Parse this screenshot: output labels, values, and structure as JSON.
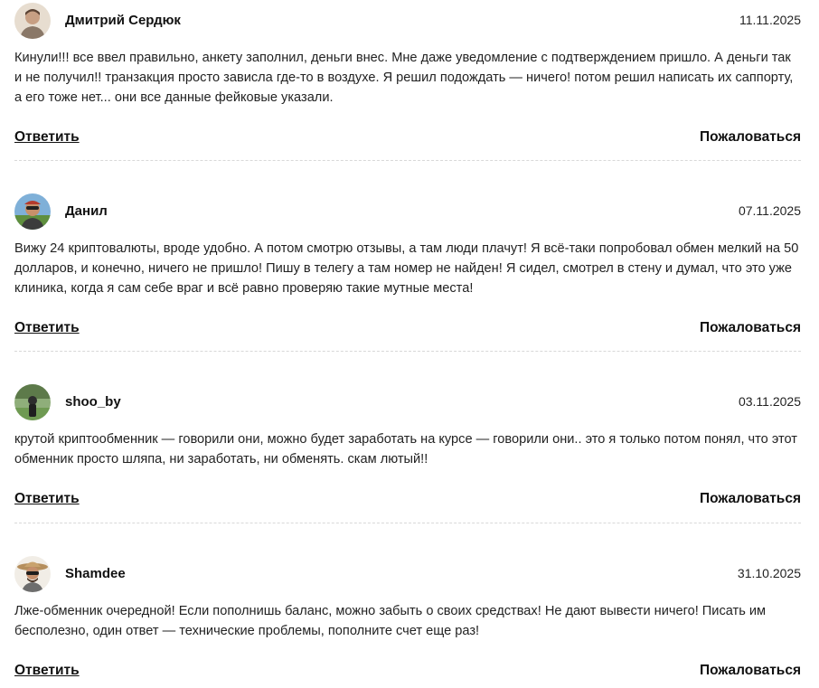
{
  "actions": {
    "reply_label": "Ответить",
    "report_label": "Пожаловаться"
  },
  "reviews": [
    {
      "author": "Дмитрий Сердюк",
      "date": "11.11.2025",
      "text": "Кинули!!! все ввел правильно, анкету заполнил, деньги внес. Мне даже уведомление с подтверждением пришло. А деньги так и не получил!! транзакция просто зависла где-то в воздухе. Я решил подождать — ничего! потом решил написать их саппорту, а его тоже нет... они все данные фейковые указали."
    },
    {
      "author": "Данил",
      "date": "07.11.2025",
      "text": "Вижу 24 криптовалюты, вроде удобно. А потом смотрю отзывы, а там люди плачут! Я всё-таки попробовал обмен мелкий на 50 долларов, и конечно, ничего не пришло! Пишу в телегу а там номер не найден! Я сидел, смотрел в стену и думал, что это уже клиника, когда я сам себе враг и всё равно проверяю такие мутные места!"
    },
    {
      "author": "shoo_by",
      "date": "03.11.2025",
      "text": "крутой криптообменник — говорили они, можно будет заработать на курсе — говорили они.. это я только потом понял, что этот обменник просто шляпа, ни заработать, ни обменять. скам лютый!!"
    },
    {
      "author": "Shamdee",
      "date": "31.10.2025",
      "text": "Лже-обменник очередной! Если пополнишь баланс, можно забыть о своих средствах! Не дают вывести ничего! Писать им бесполезно, один ответ — технические проблемы, пополните счет еще раз!"
    }
  ]
}
